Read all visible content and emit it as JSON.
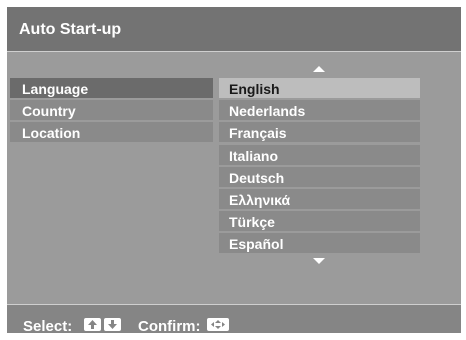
{
  "header": {
    "title": "Auto Start-up"
  },
  "settings": {
    "items": [
      {
        "label": "Language"
      },
      {
        "label": "Country"
      },
      {
        "label": "Location"
      }
    ],
    "selected_index": 0
  },
  "language_list": {
    "options": [
      "English",
      "Nederlands",
      "Français",
      "Italiano",
      "Deutsch",
      "Ελληνικά",
      "Türkçe",
      "Español"
    ],
    "highlighted_index": 0
  },
  "footer": {
    "select_label": "Select:",
    "confirm_label": "Confirm:"
  },
  "icons": [
    "scroll-up-arrow-icon",
    "scroll-down-arrow-icon",
    "up-key-icon",
    "down-key-icon",
    "enter-key-icon"
  ]
}
